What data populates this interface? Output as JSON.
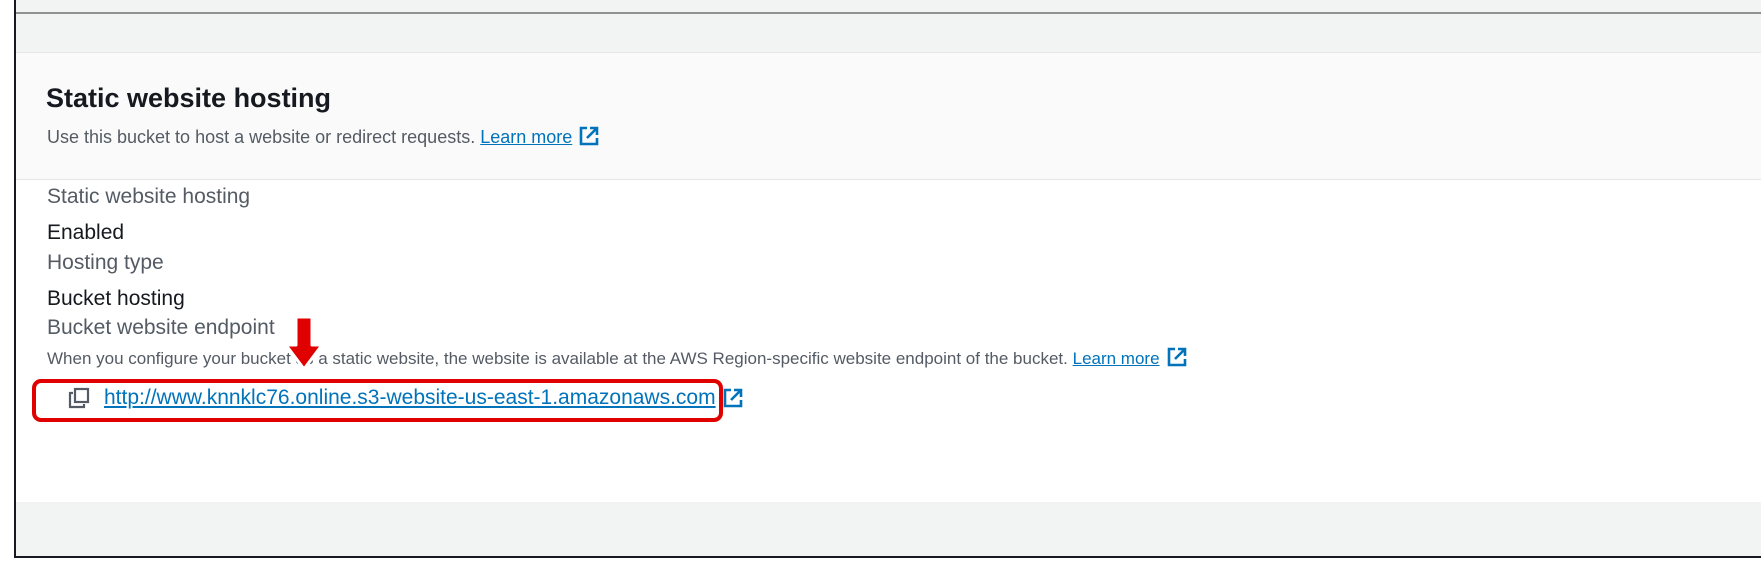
{
  "section": {
    "title": "Static website hosting",
    "description": "Use this bucket to host a website or redirect requests.",
    "learn_more": "Learn more"
  },
  "fields": {
    "hosting_label": "Static website hosting",
    "hosting_value": "Enabled",
    "type_label": "Hosting type",
    "type_value": "Bucket hosting",
    "endpoint_label": "Bucket website endpoint",
    "endpoint_description": "When you configure your bucket as a static website, the website is available at the AWS Region-specific website endpoint of the bucket.",
    "endpoint_learn_more": "Learn more",
    "endpoint_url": "http://www.knnklc76.online.s3-website-us-east-1.amazonaws.com"
  },
  "icons": {
    "external_link": "external-link-icon",
    "copy": "copy-icon",
    "annotation_arrow": "down-arrow-icon"
  },
  "colors": {
    "link": "#0073bb",
    "highlight": "#e00000",
    "header_bg": "#fafafa",
    "page_bg": "#f2f3f3"
  }
}
